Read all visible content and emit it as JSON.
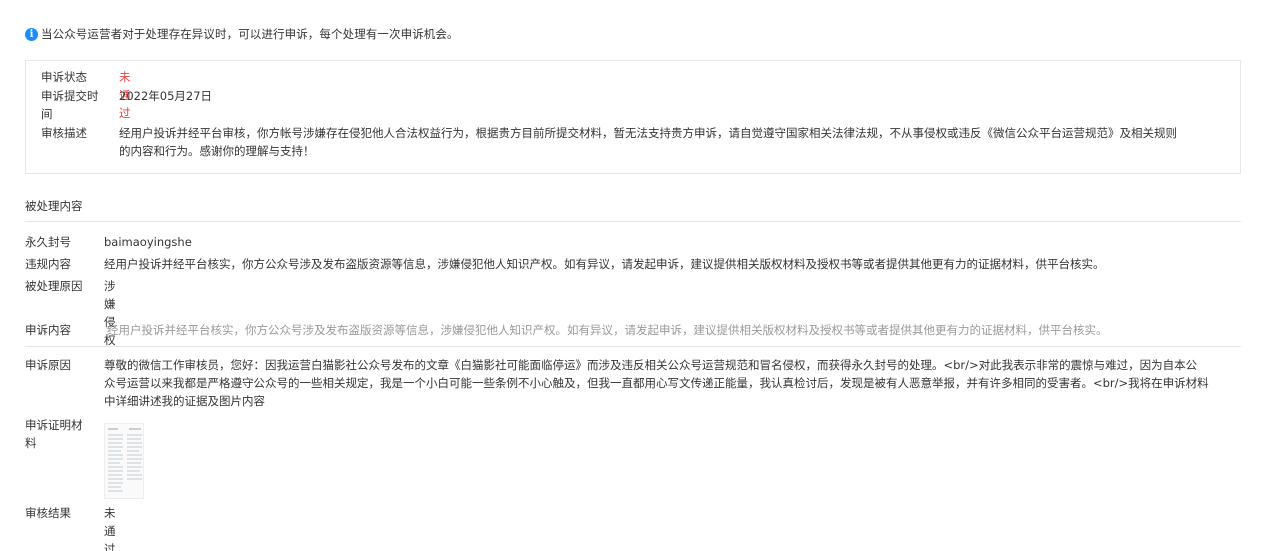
{
  "notice": {
    "icon": "info-icon",
    "text": "当公众号运营者对于处理存在异议时，可以进行申诉，每个处理有一次申诉机会。"
  },
  "appeal_box": {
    "status_label": "申诉状态",
    "status_value": "未通过",
    "submit_time_label_line1": "申诉提交时",
    "submit_time_label_line2": "间",
    "submit_time_value": "2022年05月27日",
    "review_desc_label": "审核描述",
    "review_desc_line1": "经用户投诉并经平台审核，你方帐号涉嫌存在侵犯他人合法权益行为，根据贵方目前所提交材料，暂无法支持贵方申诉，请自觉遵守国家相关法律法规，不从事侵权或违反《微信公众平台运营规范》及相关规则",
    "review_desc_line2": "的内容和行为。感谢你的理解与支持！"
  },
  "handled": {
    "section_title": "被处理内容",
    "ban_label": "永久封号",
    "ban_value": "baimaoyingshe",
    "violation_label": "违规内容",
    "violation_value": "经用户投诉并经平台核实，你方公众号涉及发布盗版资源等信息，涉嫌侵犯他人知识产权。如有异议，请发起申诉，建议提供相关版权材料及授权书等或者提供其他更有力的证据材料，供平台核实。",
    "reason_label": "被处理原因",
    "reason_value": "涉嫌侵权"
  },
  "appeal_content": {
    "label": "申诉内容",
    "value": "经用户投诉并经平台核实，你方公众号涉及发布盗版资源等信息，涉嫌侵犯他人知识产权。如有异议，请发起申诉，建议提供相关版权材料及授权书等或者提供其他更有力的证据材料，供平台核实。"
  },
  "appeal_reason": {
    "label": "申诉原因",
    "line1": "尊敬的微信工作审核员，您好：因我运营白猫影社公众号发布的文章《白猫影社可能面临停运》而涉及违反相关公众号运营规范和冒名侵权，而获得永久封号的处理。<br/>对此我表示非常的震惊与难过，因为自本公",
    "line2": "众号运营以来我都是严格遵守公众号的一些相关规定，我是一个小白可能一些条例不小心触及，但我一直都用心写文传递正能量，我认真检讨后，发现是被有人恶意举报，并有许多相同的受害者。<br/>我将在申诉材料",
    "line3": "中详细讲述我的证据及图片内容"
  },
  "evidence": {
    "label_line1": "申诉证明材",
    "label_line2": "料"
  },
  "review_result": {
    "label": "审核结果",
    "value": "未通过"
  },
  "colors": {
    "accent": "#1a8cff",
    "failed": "#e64340",
    "border": "#e4e8eb",
    "muted": "#9a9a9a"
  }
}
